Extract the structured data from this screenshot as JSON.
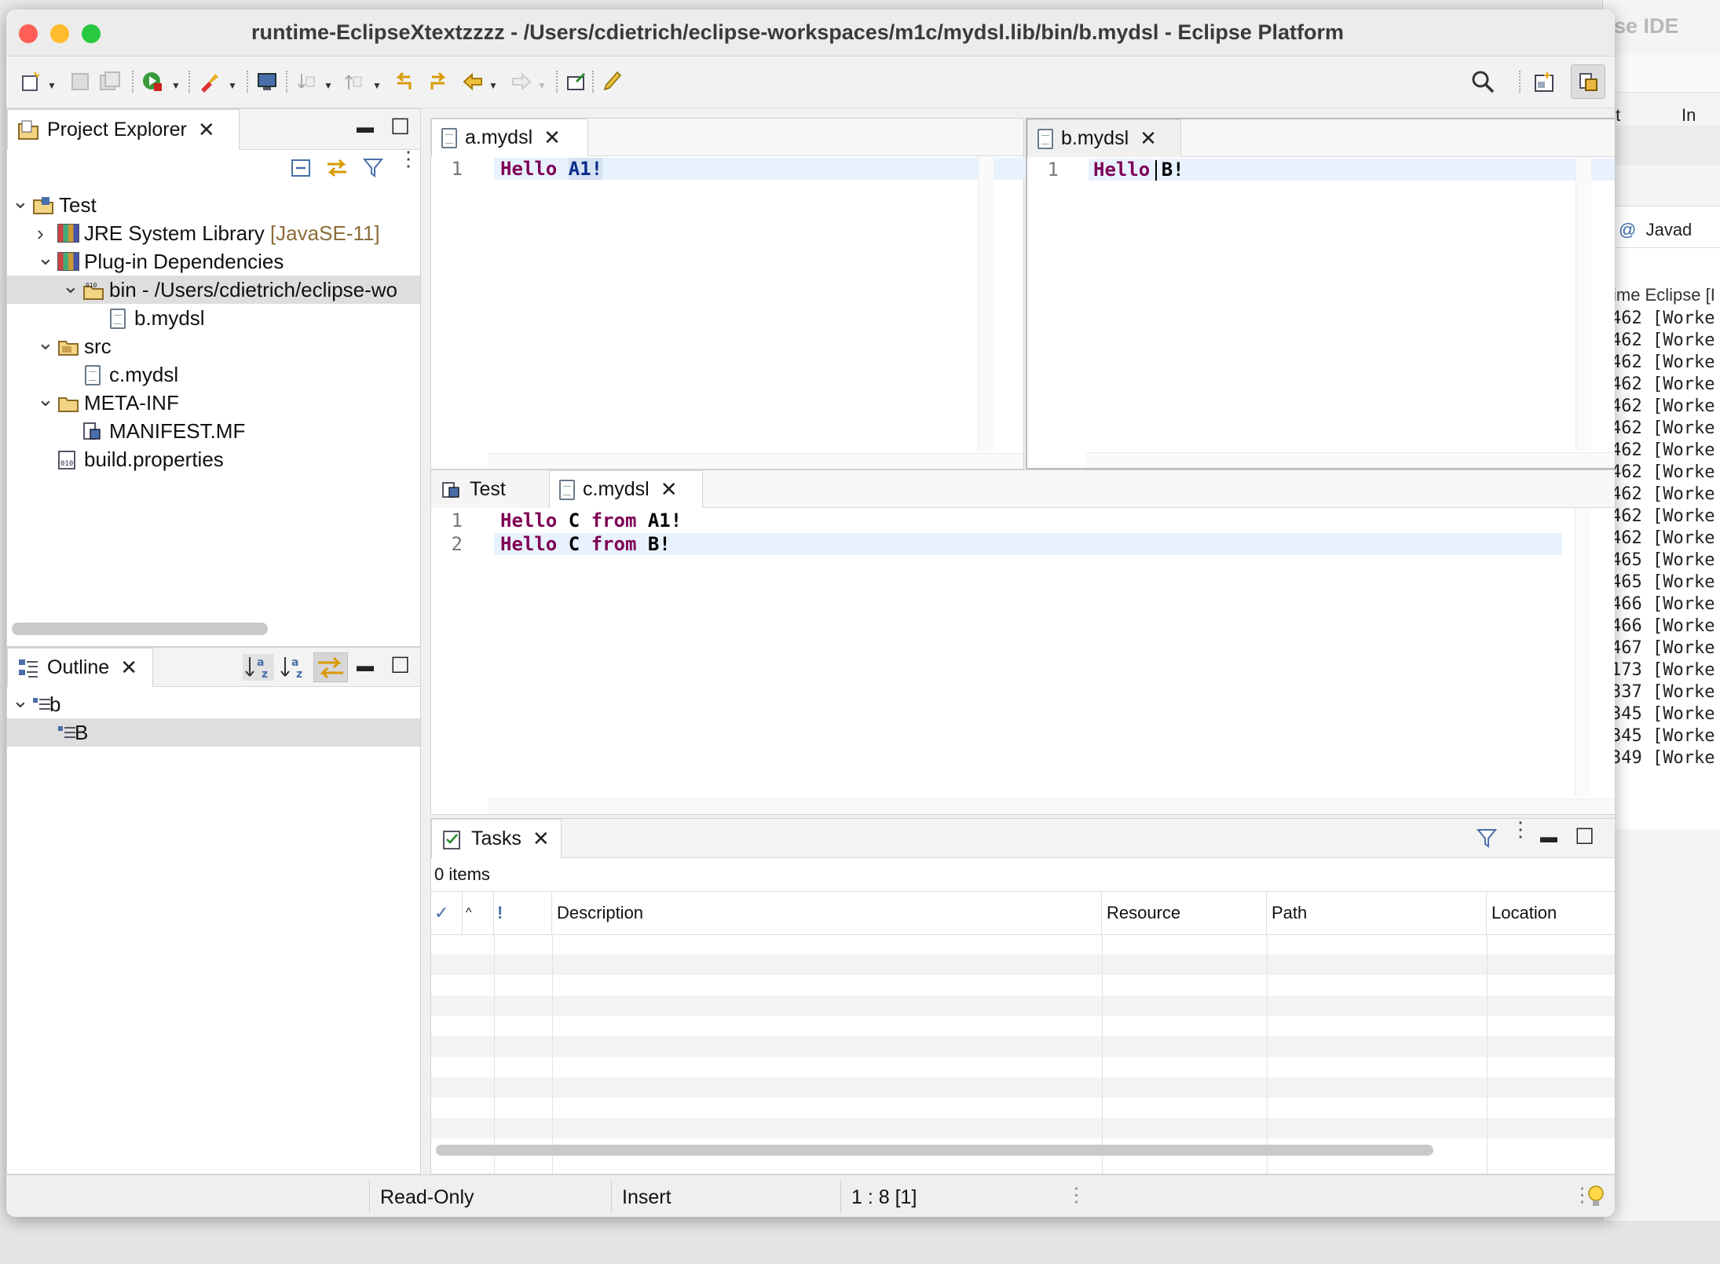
{
  "window": {
    "title": "runtime-EclipseXtextzzzz - /Users/cdietrich/eclipse-workspaces/m1c/mydsl.lib/bin/b.mydsl - Eclipse Platform",
    "traffic_colors": {
      "close": "#ff5f57",
      "minimize": "#febc2e",
      "zoom": "#28c840"
    }
  },
  "background_window": {
    "title": "se IDE",
    "tab_fragments": [
      "ıt",
      "In"
    ],
    "javadoc_tab": "Javad",
    "run_title": "ime Eclipse [I",
    "log_lines": [
      "462 [Worke",
      "462 [Worke",
      "462 [Worke",
      "462 [Worke",
      "462 [Worke",
      "462 [Worke",
      "462 [Worke",
      "462 [Worke",
      "462 [Worke",
      "462 [Worke",
      "462 [Worke",
      "465 [Worke",
      "465 [Worke",
      "466 [Worke",
      "466 [Worke",
      "467 [Worke",
      "173 [Worke",
      "337 [Worke",
      "345 [Worke",
      "345 [Worke",
      "349 [Worke"
    ]
  },
  "toolbar": {
    "icons": [
      "new-wizard-icon",
      "save-icon",
      "save-all-icon",
      "run-icon",
      "external-tools-icon",
      "terminal-icon",
      "next-annotation-icon",
      "previous-annotation-icon",
      "last-edit-location-icon",
      "next-edit-icon",
      "back-icon",
      "forward-icon",
      "open-task-icon",
      "annotate-icon"
    ],
    "search_icon": "search-icon",
    "perspective_icons": [
      "open-perspective-icon",
      "plugin-development-perspective-icon"
    ]
  },
  "project_explorer": {
    "tab_label": "Project Explorer",
    "tree": [
      {
        "label": "Test",
        "level": 0,
        "expanded": true,
        "icon": "project-icon"
      },
      {
        "label": "JRE System Library",
        "decoration": "[JavaSE-11]",
        "level": 1,
        "expanded": false,
        "icon": "library-icon"
      },
      {
        "label": "Plug-in Dependencies",
        "level": 1,
        "expanded": true,
        "icon": "library-icon"
      },
      {
        "label": "bin - /Users/cdietrich/eclipse-wo",
        "level": 2,
        "expanded": true,
        "icon": "class-folder-icon",
        "selected": true
      },
      {
        "label": "b.mydsl",
        "level": 3,
        "icon": "file-icon"
      },
      {
        "label": "src",
        "level": 1,
        "expanded": true,
        "icon": "source-folder-icon"
      },
      {
        "label": "c.mydsl",
        "level": 2,
        "icon": "file-icon"
      },
      {
        "label": "META-INF",
        "level": 1,
        "expanded": true,
        "icon": "folder-icon"
      },
      {
        "label": "MANIFEST.MF",
        "level": 2,
        "icon": "manifest-icon"
      },
      {
        "label": "build.properties",
        "level": 1,
        "icon": "properties-icon"
      }
    ]
  },
  "outline": {
    "tab_label": "Outline",
    "tree": [
      {
        "label": "b",
        "level": 0,
        "expanded": true
      },
      {
        "label": "B",
        "level": 1,
        "selected": true
      }
    ]
  },
  "editors": {
    "a": {
      "tab_label": "a.mydsl",
      "lines": [
        {
          "num": "1",
          "kw": "Hello",
          "rest": "A1!"
        }
      ]
    },
    "b": {
      "tab_label": "b.mydsl",
      "lines": [
        {
          "num": "1",
          "kw": "Hello",
          "rest": "B!"
        }
      ]
    },
    "c": {
      "tabs": [
        {
          "label": "Test",
          "icon": "manifest-icon"
        },
        {
          "label": "c.mydsl",
          "icon": "file-icon"
        }
      ],
      "lines": [
        {
          "num": "1",
          "kw": "Hello",
          "mid": "C",
          "kw2": "from",
          "rest": "A1!"
        },
        {
          "num": "2",
          "kw": "Hello",
          "mid": "C",
          "kw2": "from",
          "rest": "B!"
        }
      ]
    }
  },
  "tasks": {
    "tab_label": "Tasks",
    "count": "0 items",
    "columns": [
      "✓",
      "^",
      "!",
      "Description",
      "Resource",
      "Path",
      "Location"
    ]
  },
  "status": {
    "mode": "Read-Only",
    "insert": "Insert",
    "position": "1 : 8 [1]"
  },
  "colors": {
    "keyword": "#7f0055",
    "current_line": "#e8f2fe",
    "selection": "#dedede"
  }
}
